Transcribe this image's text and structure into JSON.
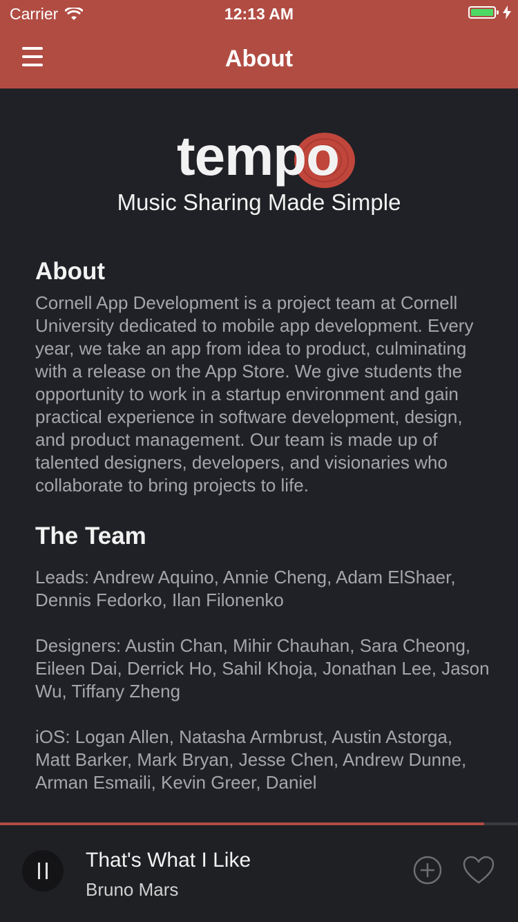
{
  "status": {
    "carrier": "Carrier",
    "time": "12:13 AM"
  },
  "nav": {
    "title": "About"
  },
  "logo": {
    "text": "tempo",
    "tagline": "Music Sharing Made Simple"
  },
  "about": {
    "heading": "About",
    "body": "Cornell App Development is a project team at Cornell University dedicated to mobile app development. Every year, we take an app from idea to product, culminating with a release on the App Store. We give students the opportunity to work in a startup environment and gain practical experience in software development, design, and product management. Our team is made up of talented designers, developers, and visionaries who collaborate to bring projects to life."
  },
  "team": {
    "heading": "The Team",
    "groups": [
      "Leads: Andrew Aquino, Annie Cheng, Adam ElShaer, Dennis Fedorko, Ilan Filonenko",
      "Designers: Austin Chan, Mihir Chauhan, Sara Cheong, Eileen Dai, Derrick Ho, Sahil Khoja, Jonathan Lee, Jason Wu, Tiffany Zheng",
      "iOS: Logan Allen, Natasha Armbrust, Austin Astorga, Matt Barker, Mark Bryan, Jesse Chen, Andrew Dunne, Arman Esmaili, Kevin Greer, Daniel"
    ]
  },
  "player": {
    "song": "That's What I Like",
    "artist": "Bruno Mars",
    "progress": 0.935
  },
  "colors": {
    "accent": "#b14c43",
    "background": "#202126",
    "battery": "#4cd964"
  },
  "icons": [
    "wifi-icon",
    "battery-icon",
    "charging-icon",
    "hamburger-menu-icon",
    "pause-icon",
    "add-icon",
    "heart-icon"
  ]
}
